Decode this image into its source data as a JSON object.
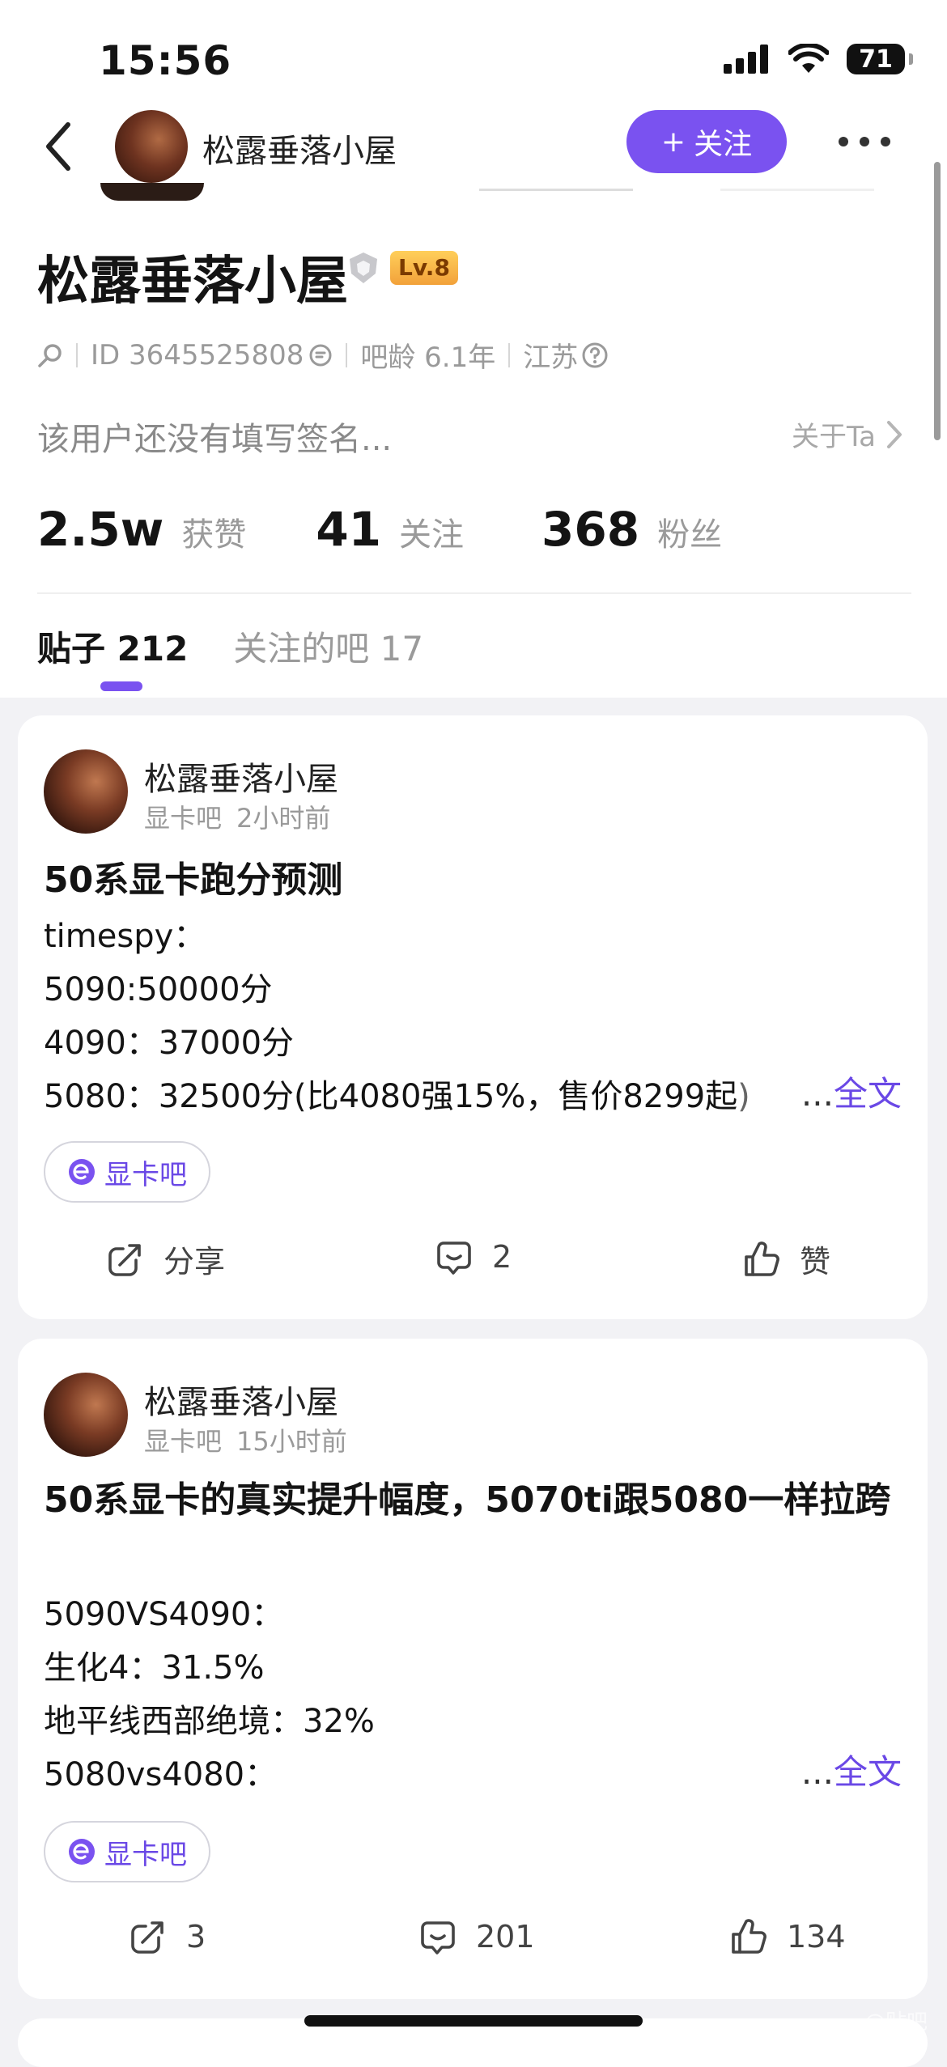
{
  "status_bar": {
    "time": "15:56",
    "battery": "71"
  },
  "nav": {
    "title": "松露垂落小屋",
    "follow_label": "关注",
    "follow_plus": "+"
  },
  "profile": {
    "name": "松露垂落小屋",
    "level": "Lv.8",
    "id_text": "ID 3645525808",
    "age_text": "吧龄 6.1年",
    "location": "江苏",
    "signature": "该用户还没有填写签名...",
    "about_label": "关于Ta"
  },
  "stats": [
    {
      "value": "2.5w",
      "label": "获赞"
    },
    {
      "value": "41",
      "label": "关注"
    },
    {
      "value": "368",
      "label": "粉丝"
    }
  ],
  "tabs": [
    {
      "label": "贴子 212",
      "active": true
    },
    {
      "label": "关注的吧 17",
      "active": false
    }
  ],
  "posts": [
    {
      "author": "松露垂落小屋",
      "forum": "显卡吧",
      "time": "2小时前",
      "title": "50系显卡跑分预测",
      "lines": [
        "timespy：",
        "5090:50000分",
        "4090：37000分",
        "5080：32500分(比4080强15%，售价8299起"
      ],
      "last_line_faded": ")",
      "full_text_dots": "...",
      "full_text_label": "全文",
      "tag": "显卡吧",
      "share_label": "分享",
      "comments": "2",
      "likes": "赞"
    },
    {
      "author": "松露垂落小屋",
      "forum": "显卡吧",
      "time": "15小时前",
      "title": "50系显卡的真实提升幅度，5070ti跟5080一样拉跨",
      "lines": [
        "5090VS4090：",
        "生化4：31.5%",
        "地平线西部绝境：32%",
        "5080vs4080："
      ],
      "full_text_dots": "...",
      "full_text_label": "全文",
      "tag": "显卡吧",
      "share_label": "3",
      "comments": "201",
      "likes": "134"
    }
  ],
  "watermark": "@贴吧"
}
